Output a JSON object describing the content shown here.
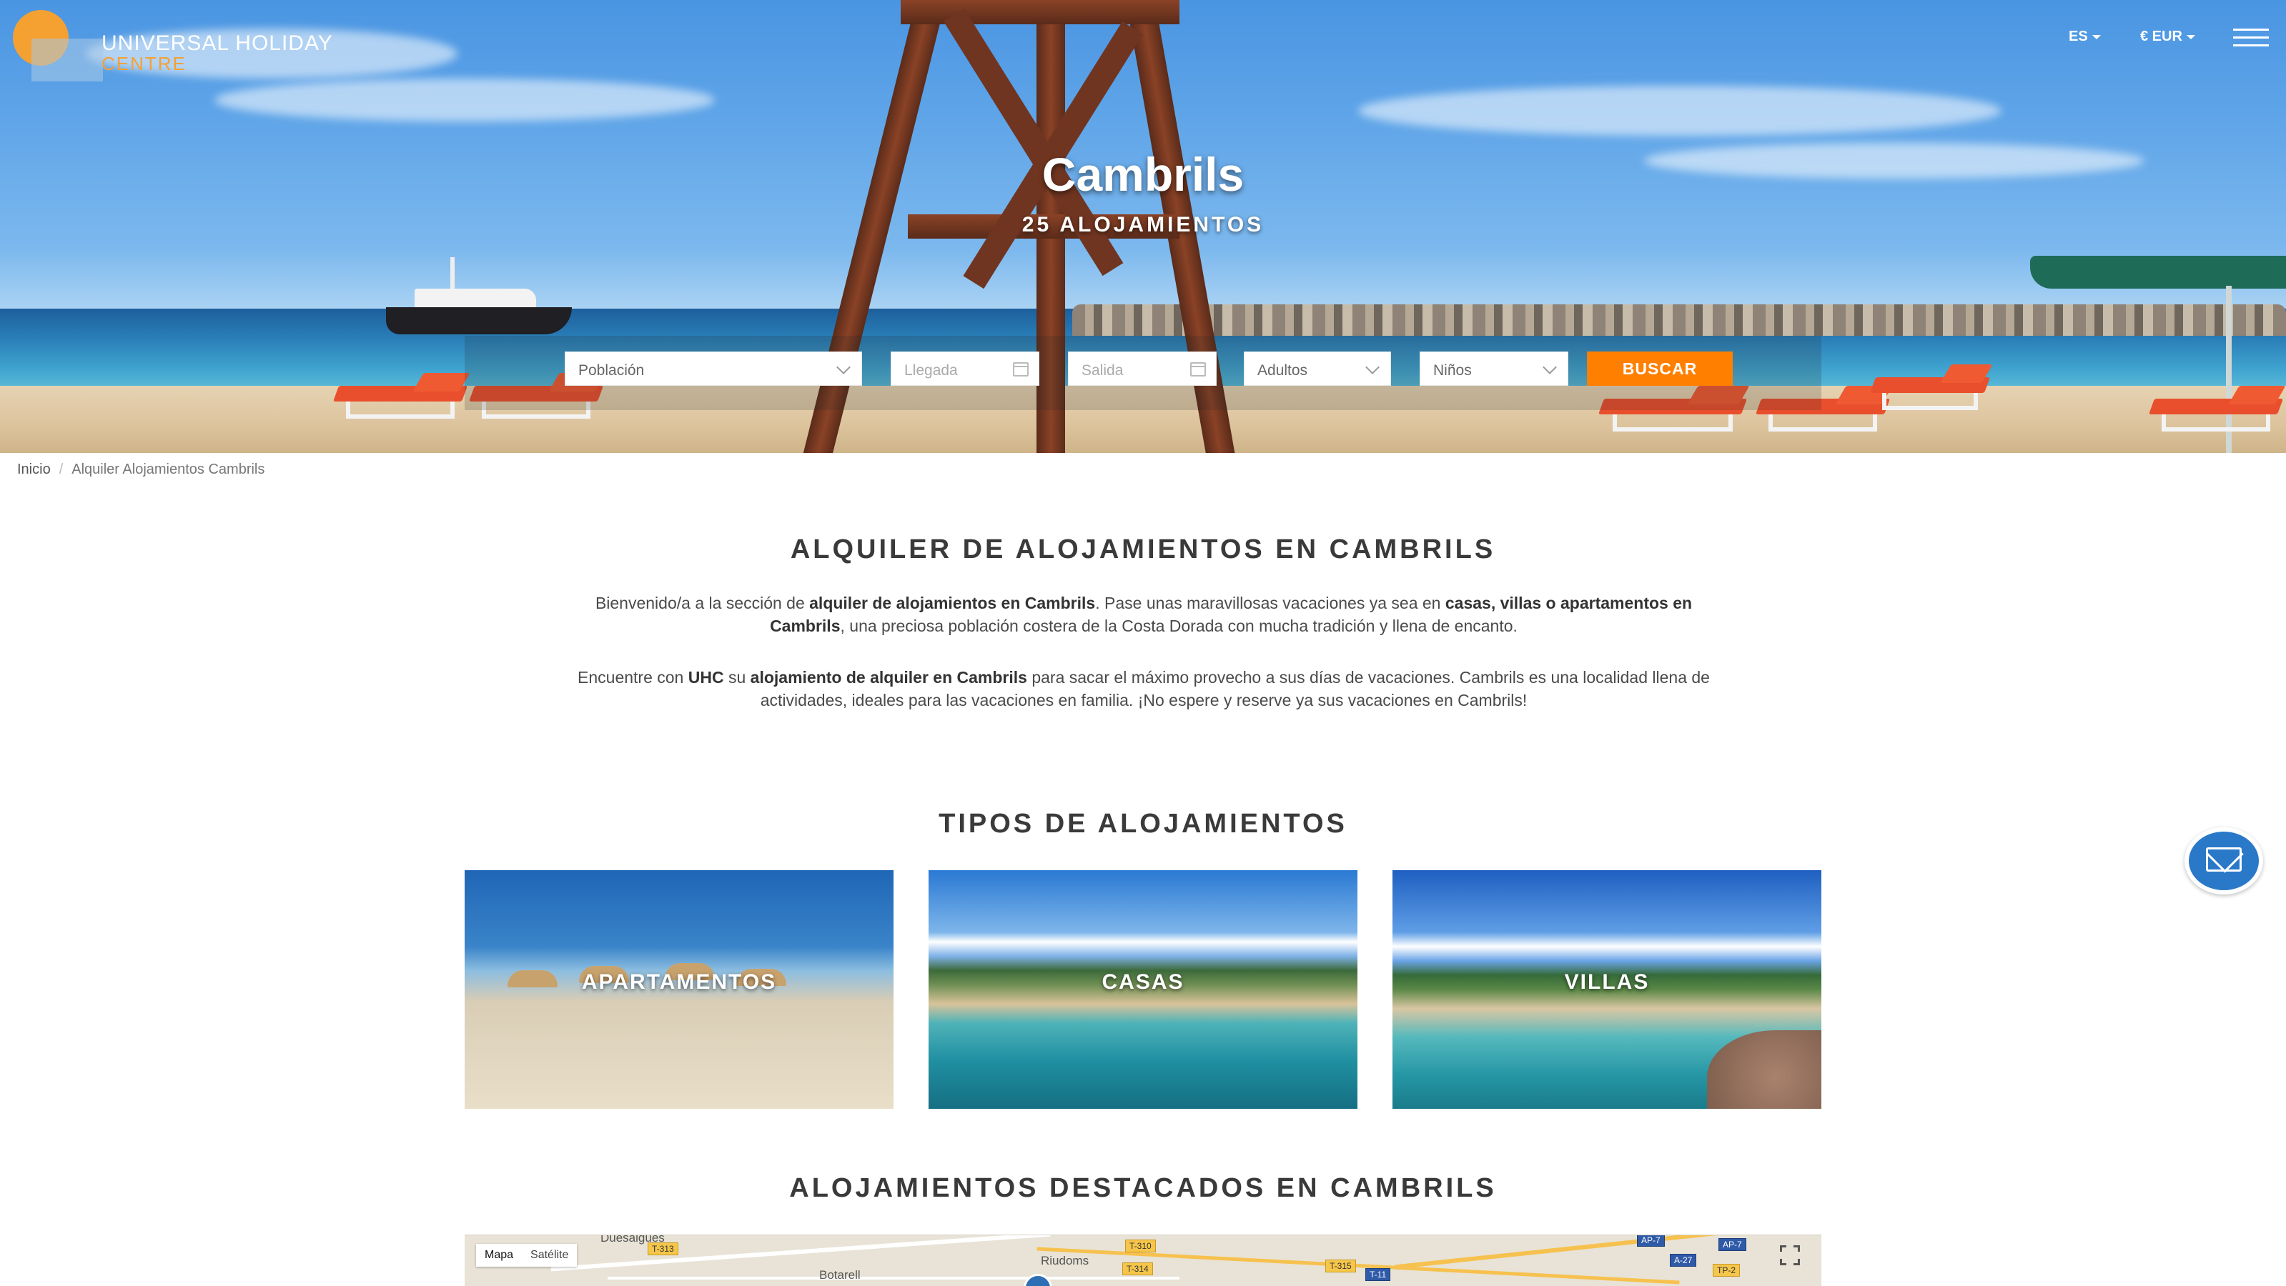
{
  "header": {
    "brand_line1": "UNIVERSAL HOLIDAY",
    "brand_line2": "CENTRE",
    "language": "ES",
    "currency": "€ EUR"
  },
  "hero": {
    "title": "Cambrils",
    "subtitle": "25 ALOJAMIENTOS"
  },
  "search": {
    "poblacion": "Población",
    "llegada": "Llegada",
    "salida": "Salida",
    "adultos": "Adultos",
    "ninos": "Niños",
    "button": "BUSCAR"
  },
  "breadcrumb": {
    "home": "Inicio",
    "separator": "/",
    "current": "Alquiler Alojamientos Cambrils"
  },
  "intro": {
    "title": "ALQUILER DE ALOJAMIENTOS EN CAMBRILS",
    "p1_a": "Bienvenido/a a la sección de ",
    "p1_b": "alquiler de alojamientos en Cambrils",
    "p1_c": ". Pase unas maravillosas vacaciones ya sea en ",
    "p1_d": "casas, villas o apartamentos en Cambrils",
    "p1_e": ", una preciosa población costera de la Costa Dorada con mucha tradición y llena de encanto.",
    "p2_a": "Encuentre con ",
    "p2_b": "UHC",
    "p2_c": " su ",
    "p2_d": "alojamiento de alquiler en Cambrils",
    "p2_e": " para sacar el máximo provecho a sus días de vacaciones. Cambrils es una localidad llena de actividades, ideales para las vacaciones en familia. ¡No espere y reserve ya sus vacaciones en Cambrils!"
  },
  "types": {
    "title": "TIPOS DE ALOJAMIENTOS",
    "items": [
      {
        "label": "APARTAMENTOS"
      },
      {
        "label": "CASAS"
      },
      {
        "label": "VILLAS"
      }
    ]
  },
  "featured": {
    "title": "ALOJAMIENTOS DESTACADOS EN CAMBRILS"
  },
  "map": {
    "tab_map": "Mapa",
    "tab_sat": "Satélite",
    "places": [
      "Duesaigües",
      "Riudoms",
      "Botarell"
    ],
    "roads": [
      "T-313",
      "T-310",
      "T-314",
      "T-315",
      "T-11",
      "AP-7",
      "AP-7",
      "A-27",
      "TP-2"
    ]
  },
  "colors": {
    "accent": "#ff7f00",
    "brand_orange": "#f4a132",
    "mail_blue": "#2a78c8"
  },
  "icons": [
    "calendar-icon",
    "chevron-down-icon",
    "menu-icon",
    "mail-icon",
    "fullscreen-icon"
  ]
}
